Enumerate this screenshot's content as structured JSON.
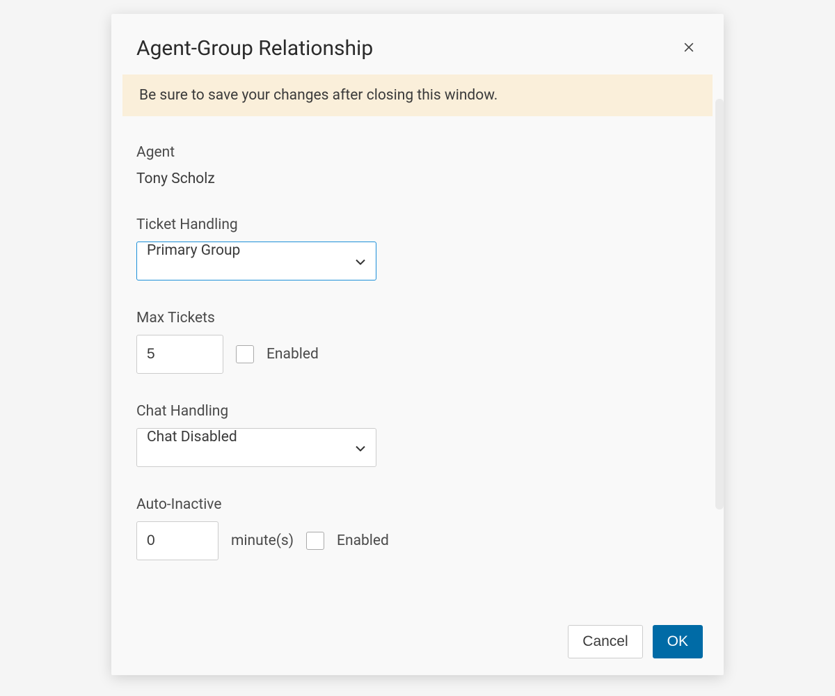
{
  "modal": {
    "title": "Agent-Group Relationship",
    "banner": "Be sure to save your changes after closing this window.",
    "agent": {
      "label": "Agent",
      "name": "Tony Scholz"
    },
    "ticketHandling": {
      "label": "Ticket Handling",
      "selected": "Primary Group"
    },
    "maxTickets": {
      "label": "Max Tickets",
      "value": "5",
      "enabledLabel": "Enabled"
    },
    "chatHandling": {
      "label": "Chat Handling",
      "selected": "Chat Disabled"
    },
    "autoInactive": {
      "label": "Auto-Inactive",
      "value": "0",
      "unit": "minute(s)",
      "enabledLabel": "Enabled"
    },
    "buttons": {
      "cancel": "Cancel",
      "ok": "OK"
    }
  }
}
